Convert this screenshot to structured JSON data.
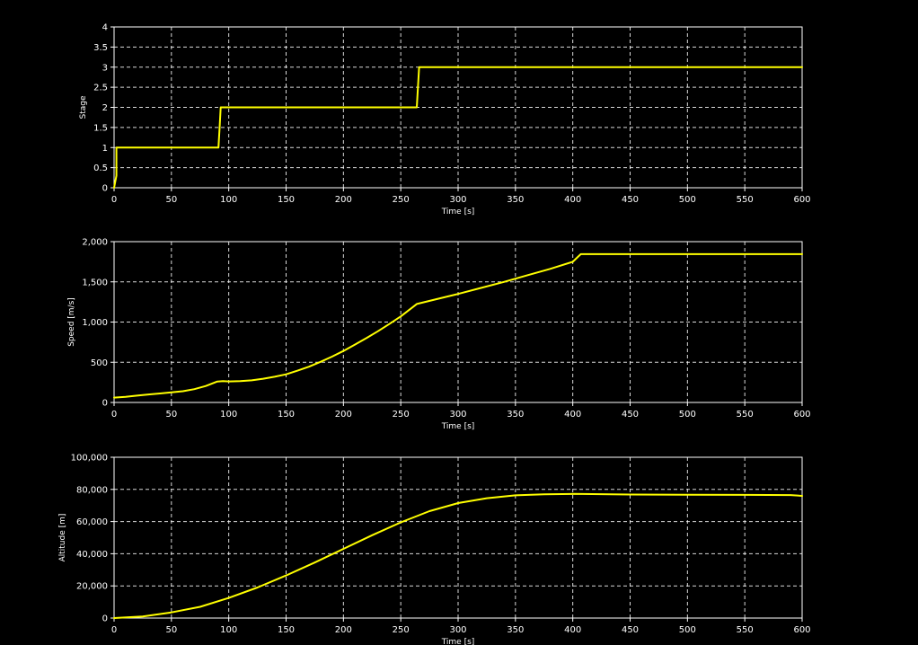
{
  "colors": {
    "background": "#000000",
    "axis": "#ffffff",
    "grid": "#ffffff",
    "series": "#ffff00"
  },
  "chart_data": [
    {
      "type": "line",
      "title": "",
      "xlabel": "Time [s]",
      "ylabel": "Stage",
      "xlim": [
        0,
        600
      ],
      "ylim": [
        0,
        4
      ],
      "xticks": [
        "0",
        "50",
        "100",
        "150",
        "200",
        "250",
        "300",
        "350",
        "400",
        "450",
        "500",
        "550",
        "600"
      ],
      "yticks": [
        "0",
        "0.5",
        "1",
        "1.5",
        "2",
        "2.5",
        "3",
        "3.5",
        "4"
      ],
      "grid": true,
      "series": [
        {
          "x": [
            0,
            2,
            2,
            91,
            92,
            93,
            264,
            265,
            266,
            600
          ],
          "y": [
            0,
            0.3,
            1,
            1,
            1.5,
            2,
            2,
            2.5,
            3,
            3
          ]
        }
      ]
    },
    {
      "type": "line",
      "title": "",
      "xlabel": "Time [s]",
      "ylabel": "Speed [m/s]",
      "xlim": [
        0,
        600
      ],
      "ylim": [
        0,
        2000
      ],
      "xticks": [
        "0",
        "50",
        "100",
        "150",
        "200",
        "250",
        "300",
        "350",
        "400",
        "450",
        "500",
        "550",
        "600"
      ],
      "yticks": [
        "0",
        "500",
        "1,000",
        "1,500",
        "2,000"
      ],
      "grid": true,
      "series": [
        {
          "x": [
            0,
            10,
            20,
            30,
            40,
            50,
            60,
            70,
            80,
            90,
            95,
            100,
            110,
            120,
            130,
            140,
            150,
            160,
            170,
            180,
            190,
            200,
            210,
            220,
            230,
            240,
            250,
            264,
            280,
            300,
            320,
            340,
            360,
            380,
            400,
            407,
            450,
            500,
            550,
            600
          ],
          "y": [
            60,
            70,
            85,
            100,
            112,
            125,
            140,
            165,
            205,
            260,
            265,
            262,
            265,
            275,
            295,
            320,
            350,
            395,
            445,
            505,
            570,
            640,
            720,
            800,
            885,
            975,
            1070,
            1225,
            1280,
            1350,
            1425,
            1500,
            1580,
            1660,
            1750,
            1845,
            1845,
            1845,
            1845,
            1845
          ]
        }
      ]
    },
    {
      "type": "line",
      "title": "",
      "xlabel": "Time [s]",
      "ylabel": "Altitude [m]",
      "xlim": [
        0,
        600
      ],
      "ylim": [
        0,
        100000
      ],
      "xticks": [
        "0",
        "50",
        "100",
        "150",
        "200",
        "250",
        "300",
        "350",
        "400",
        "450",
        "500",
        "550",
        "600"
      ],
      "yticks": [
        "0",
        "20,000",
        "40,000",
        "60,000",
        "80,000",
        "100,000"
      ],
      "grid": true,
      "series": [
        {
          "x": [
            0,
            25,
            50,
            75,
            100,
            125,
            150,
            175,
            200,
            225,
            250,
            275,
            300,
            325,
            350,
            375,
            400,
            450,
            500,
            550,
            590,
            600
          ],
          "y": [
            0,
            1000,
            3500,
            7000,
            12500,
            19000,
            26500,
            34500,
            43000,
            51500,
            59500,
            66500,
            71500,
            74500,
            76300,
            77000,
            77200,
            76800,
            76700,
            76600,
            76500,
            76000
          ]
        }
      ]
    }
  ]
}
